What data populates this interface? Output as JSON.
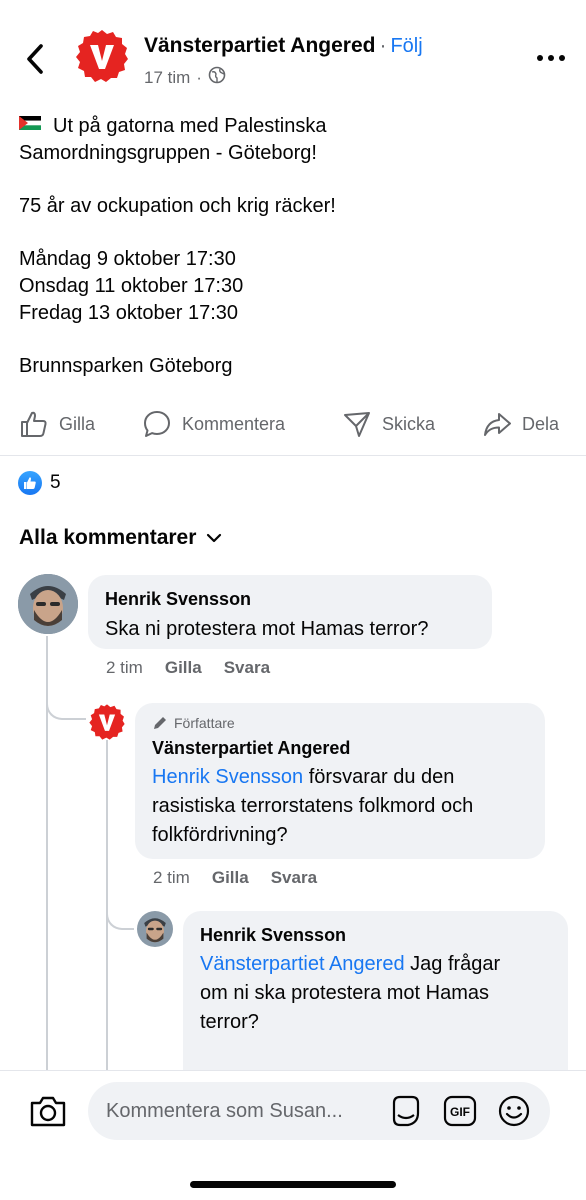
{
  "header": {
    "page_name": "Vänsterpartiet Angered",
    "separator": "·",
    "follow_label": "Följ",
    "time": "17 tim",
    "dot": "·",
    "privacy_icon": "globe-icon"
  },
  "post": {
    "flag_icon": "palestine-flag",
    "line1": "Ut på gatorna med Palestinska",
    "line2": "Samordningsgruppen - Göteborg!",
    "line3": "75 år av ockupation och krig räcker!",
    "line4": "Måndag 9 oktober 17:30",
    "line5": "Onsdag 11 oktober 17:30",
    "line6": "Fredag 13 oktober 17:30",
    "line7": "Brunnsparken Göteborg"
  },
  "actions": {
    "like": "Gilla",
    "comment": "Kommentera",
    "send": "Skicka",
    "share": "Dela"
  },
  "reactions": {
    "count": "5"
  },
  "comments_header": "Alla kommentarer",
  "comments": [
    {
      "name": "Henrik Svensson",
      "text": "Ska ni protestera mot Hamas terror?",
      "time": "2 tim",
      "like": "Gilla",
      "reply": "Svara"
    },
    {
      "badge": "Författare",
      "name": "Vänsterpartiet Angered",
      "mention": "Henrik Svensson",
      "text_line1": " försvarar du den",
      "text_line2": "rasistiska terrorstatens folkmord och",
      "text_line3": "folkfördrivning?",
      "time": "2 tim",
      "like": "Gilla",
      "reply": "Svara"
    },
    {
      "name": "Henrik Svensson",
      "mention": "Vänsterpartiet Angered",
      "text_line1": " Jag frågar",
      "text_line2": "om ni ska protestera mot Hamas",
      "text_line3": "terror?"
    }
  ],
  "composer": {
    "placeholder": "Kommentera som Susan..."
  },
  "colors": {
    "accent": "#1877f2",
    "party_red": "#e52421",
    "bubble": "#f0f2f5",
    "secondary_text": "#65676b"
  }
}
